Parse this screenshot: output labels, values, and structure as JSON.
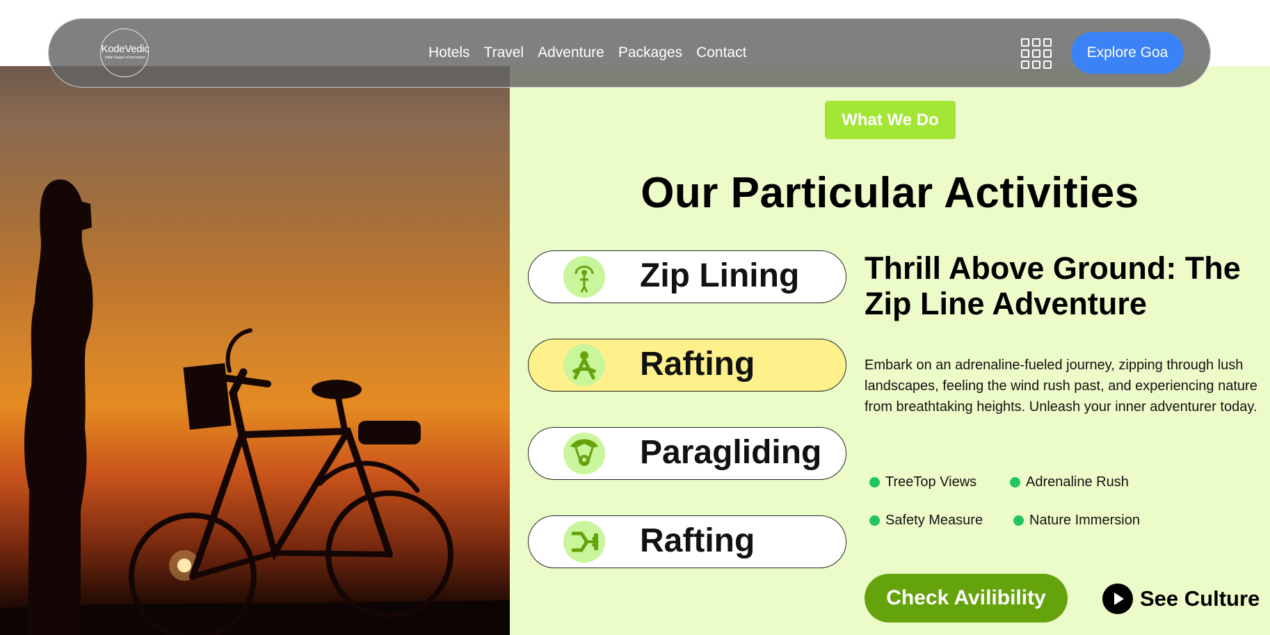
{
  "nav": {
    "logo_name": "KodeVedic",
    "logo_tagline": "Initial Stages of Innovation",
    "links": [
      "Hotels",
      "Travel",
      "Adventure",
      "Packages",
      "Contact"
    ],
    "cta": "Explore Goa"
  },
  "section": {
    "badge": "What We Do",
    "title": "Our Particular Activities"
  },
  "activities": [
    {
      "label": "Zip Lining",
      "icon": "zip-line-icon",
      "active": false
    },
    {
      "label": "Rafting",
      "icon": "rafting-icon",
      "active": true
    },
    {
      "label": "Paragliding",
      "icon": "paragliding-icon",
      "active": false
    },
    {
      "label": "Rafting",
      "icon": "rafting-alt-icon",
      "active": false
    }
  ],
  "detail": {
    "title": "Thrill Above Ground: The Zip Line Adventure",
    "description": "Embark on an adrenaline-fueled journey, zipping through lush landscapes, feeling the wind rush past, and experiencing nature from breathtaking heights. Unleash your inner adventurer today.",
    "features": [
      "TreeTop Views",
      "Adrenaline Rush",
      "Safety Measure",
      "Nature Immersion"
    ],
    "primary_cta": "Check Avilibility",
    "secondary_cta": "See Culture"
  },
  "colors": {
    "panel_bg": "#ecfcc9",
    "badge": "#a3e635",
    "active_activity": "#fef08a",
    "cta_green": "#65a30d",
    "cta_blue": "#3b82f6",
    "feature_dot": "#22c55e"
  }
}
